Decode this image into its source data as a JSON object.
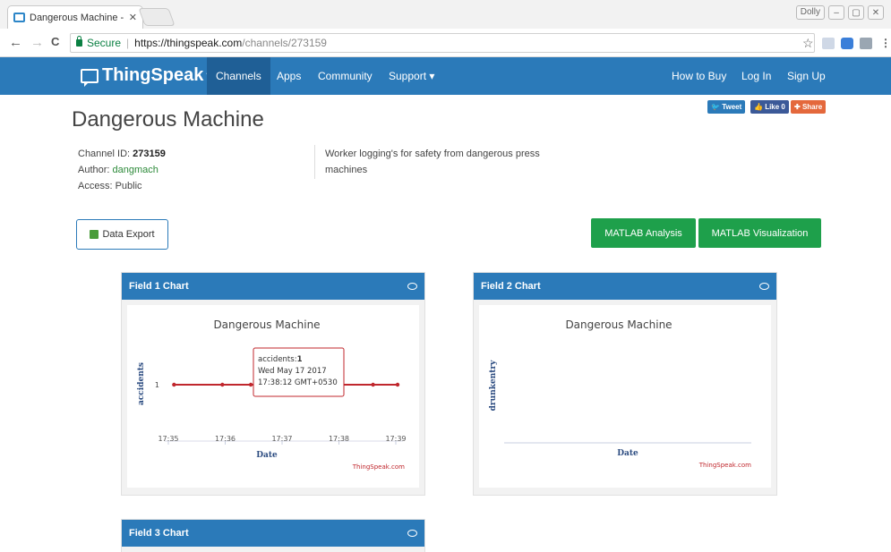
{
  "browser": {
    "tab_title": "Dangerous Machine - Th",
    "tab_close": "✕",
    "profile_label": "Dolly",
    "window_controls": [
      "–",
      "▢",
      "✕"
    ],
    "nav_back": "←",
    "nav_forward": "→",
    "nav_reload": "C",
    "secure_label": "Secure",
    "url_host": "https://thingspeak.com",
    "url_path": "/channels/273159",
    "bookmark_icon": "☆"
  },
  "site_nav": {
    "logo_text": "ThingSpeak",
    "logo_tm": "™",
    "items": [
      {
        "label": "Channels"
      },
      {
        "label": "Apps"
      },
      {
        "label": "Community"
      },
      {
        "label": "Support ▾"
      }
    ],
    "right_items": [
      {
        "label": "How to Buy"
      },
      {
        "label": "Log In"
      },
      {
        "label": "Sign Up"
      }
    ]
  },
  "channel": {
    "title": "Dangerous Machine",
    "id_label": "Channel ID:",
    "id_value": "273159",
    "author_label": "Author:",
    "author_value": "dangmach",
    "access_label": "Access:",
    "access_value": "Public",
    "description": "Worker logging's for safety from dangerous press machines"
  },
  "social": {
    "tweet": "Tweet",
    "like": "Like 0",
    "share": "Share"
  },
  "buttons": {
    "data_export": "Data Export",
    "matlab_analysis": "MATLAB Analysis",
    "matlab_visualization": "MATLAB Visualization"
  },
  "colors": {
    "nav_blue": "#2b7ab9",
    "green_button": "#1ea04b",
    "series_red": "#c0272d"
  },
  "panels": [
    {
      "title": "Field 1 Chart"
    },
    {
      "title": "Field 2 Chart"
    },
    {
      "title": "Field 3 Chart"
    }
  ],
  "chart_data": [
    {
      "type": "line",
      "title": "Dangerous Machine",
      "xlabel": "Date",
      "ylabel": "accidents",
      "x_ticks": [
        "17:35",
        "17:36",
        "17:37",
        "17:38",
        "17:39"
      ],
      "y_ticks": [
        "1"
      ],
      "x_range_minutes": [
        0,
        4
      ],
      "series": [
        {
          "x_minutes": [
            0.1,
            0.95,
            1.45,
            1.85,
            2.3,
            3.6,
            4.3
          ],
          "y": [
            1,
            1,
            1,
            1,
            1,
            1,
            1
          ]
        }
      ],
      "tooltip": {
        "label": "accidents:",
        "value": "1",
        "date": "Wed May 17 2017",
        "time": "17:38:12 GMT+0530"
      },
      "credit": "ThingSpeak.com"
    },
    {
      "type": "line",
      "title": "Dangerous Machine",
      "xlabel": "Date",
      "ylabel": "drunkentry",
      "series": [],
      "credit": "ThingSpeak.com"
    }
  ]
}
